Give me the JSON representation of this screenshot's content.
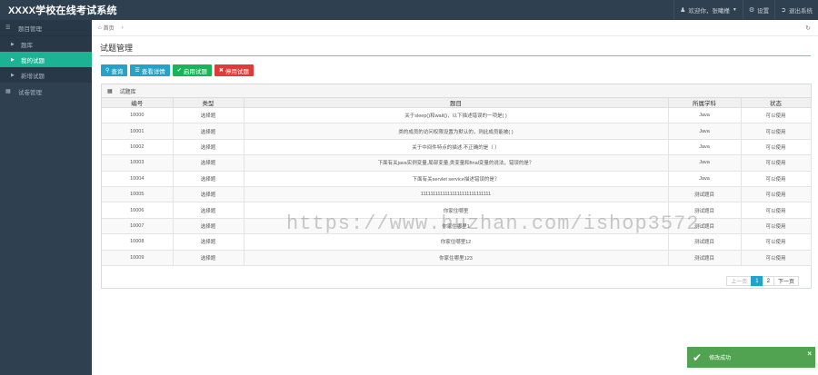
{
  "app": {
    "title": "XXXX学校在线考试系统"
  },
  "topbar": {
    "welcome_label": "欢迎你，张曦槿",
    "settings_label": "设置",
    "logout_label": "退出系统"
  },
  "sidebar": {
    "groups": [
      {
        "label": "题目管理",
        "items": [
          {
            "label": "题库"
          },
          {
            "label": "我的试题"
          },
          {
            "label": "新增试题"
          }
        ]
      },
      {
        "label": "试卷管理"
      }
    ]
  },
  "breadcrumb": {
    "home": "首页"
  },
  "page": {
    "title": "试题管理"
  },
  "toolbar": {
    "query_label": "查询",
    "detail_label": "查看详情",
    "enable_label": "启用试题",
    "disable_label": "停用试题"
  },
  "panel": {
    "title": "试题库"
  },
  "table": {
    "headers": [
      "编号",
      "类型",
      "题目",
      "所属学科",
      "状态"
    ],
    "rows": [
      [
        "10000",
        "选择题",
        "关于sleep()和wait()，以下描述错误的一项是( )",
        "Java",
        "可以使用"
      ],
      [
        "10001",
        "选择题",
        "类的成员的访问权限设置为默认的，则此成员能被( )",
        "Java",
        "可以使用"
      ],
      [
        "10002",
        "选择题",
        "关于中间件特点的描述.不正确的是（ ）",
        "Java",
        "可以使用"
      ],
      [
        "10003",
        "选择题",
        "下面有关java实例变量,局部变量,类变量和final变量的说法，错误的是？",
        "Java",
        "可以使用"
      ],
      [
        "10004",
        "选择题",
        "下面有关servlet service描述错误的是？",
        "Java",
        "可以使用"
      ],
      [
        "10005",
        "选择题",
        "11111111111111111111111111111",
        "测试题目",
        "可以使用"
      ],
      [
        "10006",
        "选择题",
        "你家住哪里",
        "测试题目",
        "可以使用"
      ],
      [
        "10007",
        "选择题",
        "你家住哪里1",
        "测试题目",
        "可以使用"
      ],
      [
        "10008",
        "选择题",
        "你家住哪里12",
        "测试题目",
        "可以使用"
      ],
      [
        "10009",
        "选择题",
        "你家住哪里123",
        "测试题目",
        "可以使用"
      ]
    ]
  },
  "pagination": {
    "prev": "上一页",
    "pages": [
      "1",
      "2"
    ],
    "next": "下一页"
  },
  "watermark": "https://www.huzhan.com/ishop3572",
  "toast": {
    "message": "修改成功",
    "close": "×"
  }
}
